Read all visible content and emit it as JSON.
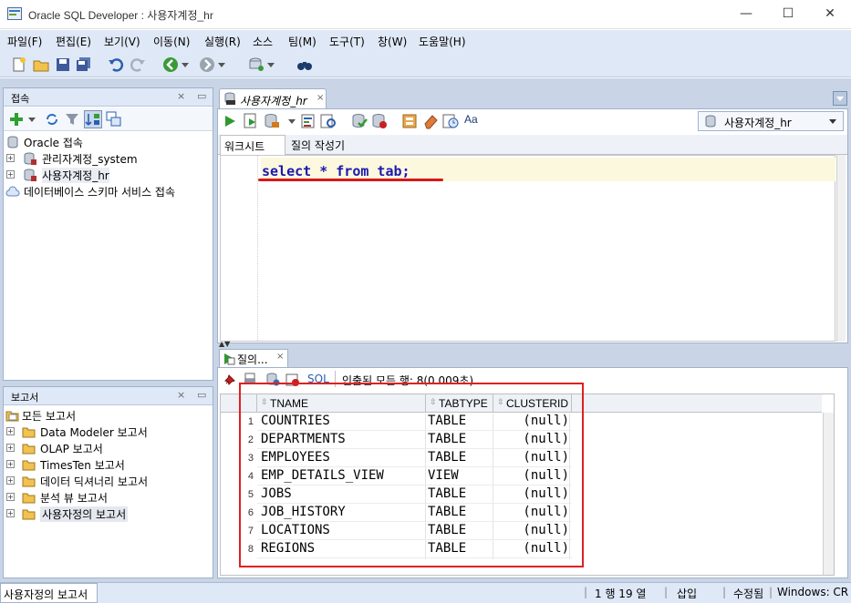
{
  "window": {
    "title": "Oracle SQL Developer : 사용자계정_hr",
    "minimize": "—",
    "maximize": "☐",
    "close": "✕"
  },
  "menu": [
    "파일(F)",
    "편집(E)",
    "보기(V)",
    "이동(N)",
    "실행(R)",
    "소스",
    "팀(M)",
    "도구(T)",
    "창(W)",
    "도움말(H)"
  ],
  "connections_panel": {
    "title": "접속",
    "items": [
      {
        "label": "Oracle 접속"
      },
      {
        "label": "관리자계정_system"
      },
      {
        "label": "사용자계정_hr"
      },
      {
        "label": "데이터베이스 스키마 서비스 접속"
      }
    ]
  },
  "reports_panel": {
    "title": "보고서",
    "items": [
      {
        "label": "모든 보고서"
      },
      {
        "label": "Data Modeler 보고서"
      },
      {
        "label": "OLAP 보고서"
      },
      {
        "label": "TimesTen 보고서"
      },
      {
        "label": "데이터 딕셔너리 보고서"
      },
      {
        "label": "분석 뷰 보고서"
      },
      {
        "label": "사용자정의 보고서"
      }
    ]
  },
  "editor": {
    "tab_label": "사용자계정_hr",
    "connection_select": "사용자계정_hr",
    "subtabs": [
      "워크시트",
      "질의 작성기"
    ],
    "sql": "select * from tab;"
  },
  "results": {
    "tab_label": "질의...",
    "sql_label": "SQL",
    "status": "인출된 모든 행: 8(0.009초)",
    "columns": [
      "TNAME",
      "TABTYPE",
      "CLUSTERID"
    ],
    "rows": [
      [
        "1",
        "COUNTRIES",
        "TABLE",
        "(null)"
      ],
      [
        "2",
        "DEPARTMENTS",
        "TABLE",
        "(null)"
      ],
      [
        "3",
        "EMPLOYEES",
        "TABLE",
        "(null)"
      ],
      [
        "4",
        "EMP_DETAILS_VIEW",
        "VIEW",
        "(null)"
      ],
      [
        "5",
        "JOBS",
        "TABLE",
        "(null)"
      ],
      [
        "6",
        "JOB_HISTORY",
        "TABLE",
        "(null)"
      ],
      [
        "7",
        "LOCATIONS",
        "TABLE",
        "(null)"
      ],
      [
        "8",
        "REGIONS",
        "TABLE",
        "(null)"
      ]
    ]
  },
  "statusbar": {
    "left": "사용자정의 보고서",
    "position": "1 행 19 열",
    "insert": "삽입",
    "modified": "수정됨",
    "os": "Windows: CR"
  },
  "colors": {
    "chrome": "#dfe8f6",
    "annotation_red": "#e02020",
    "sql_keyword": "#1a1ab0"
  }
}
